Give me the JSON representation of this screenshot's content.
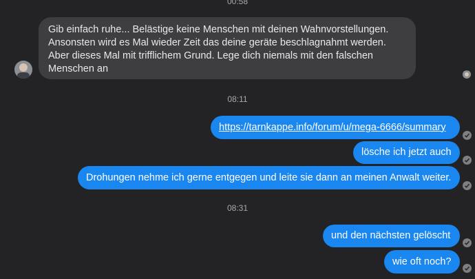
{
  "timestamps": {
    "top": "00:58",
    "middle": "08:11",
    "bottom": "08:31"
  },
  "incoming": {
    "text": "Gib einfach ruhe... Belästige keine Menschen mit deinen Wahnvorstellungen. Ansonsten wird es Mal wieder Zeit das deine geräte beschlagnahmt werden. Aber dieses Mal mit trifflichem Grund. Lege dich niemals mit den falschen Menschen an"
  },
  "outgoing": [
    {
      "text": "https://tarnkappe.info/forum/u/mega-6666/summary"
    },
    {
      "text": "lösche ich jetzt auch"
    },
    {
      "text": "Drohungen nehme ich gerne entgegen und leite sie dann an meinen Anwalt weiter."
    },
    {
      "text": "und den nächsten gelöscht"
    },
    {
      "text": "wie oft noch?"
    }
  ],
  "colors": {
    "background": "#232325",
    "incoming_bubble": "#3e3e41",
    "outgoing_bubble": "#1a86f0"
  }
}
